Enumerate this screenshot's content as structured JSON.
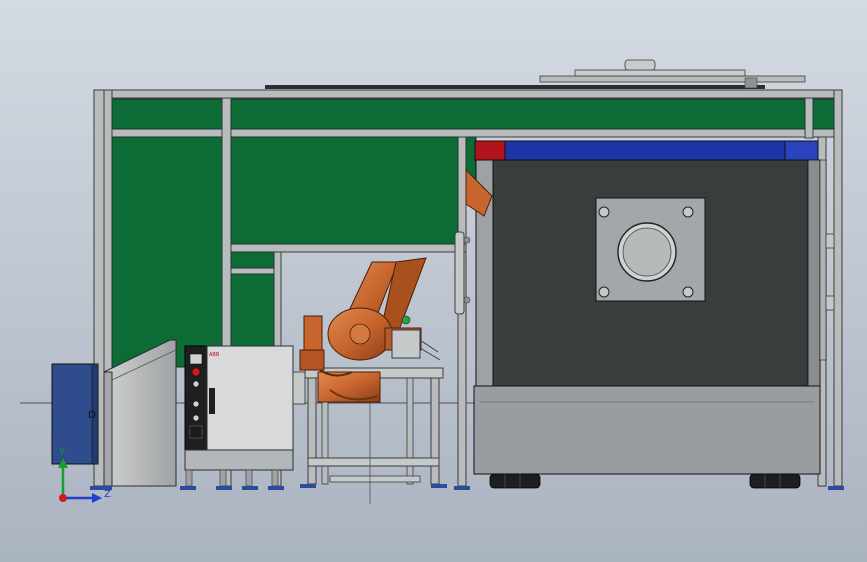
{
  "viewport": {
    "background_top": "#d4dae2",
    "background_bottom": "#aab3c0"
  },
  "colors": {
    "frame_gray": "#b9bcbd",
    "frame_stroke": "#3a3d40",
    "panel_green": "#0d6b35",
    "machine_dark": "#383d3e",
    "machine_base": "#9a9d9f",
    "top_bar_blue": "#1d33a8",
    "top_bar_red": "#b3141c",
    "robot_orange": "#c8652e",
    "controller_blue": "#2f4c8c",
    "foot_blue": "#2a4c9a"
  },
  "triad": {
    "y_label": "Y",
    "z_label": "Z",
    "y_color": "#1a9d2a",
    "z_color": "#1e3fd0",
    "origin_color": "#d01a1a"
  },
  "labels": {
    "controller_brand": "ABB",
    "box_marker": "D"
  },
  "components": {
    "frame": "enclosure-frame",
    "machine": "machine-tool",
    "robot": "industrial-robot",
    "controller": "robot-controller",
    "pendant": "operator-console",
    "table": "robot-stand"
  }
}
